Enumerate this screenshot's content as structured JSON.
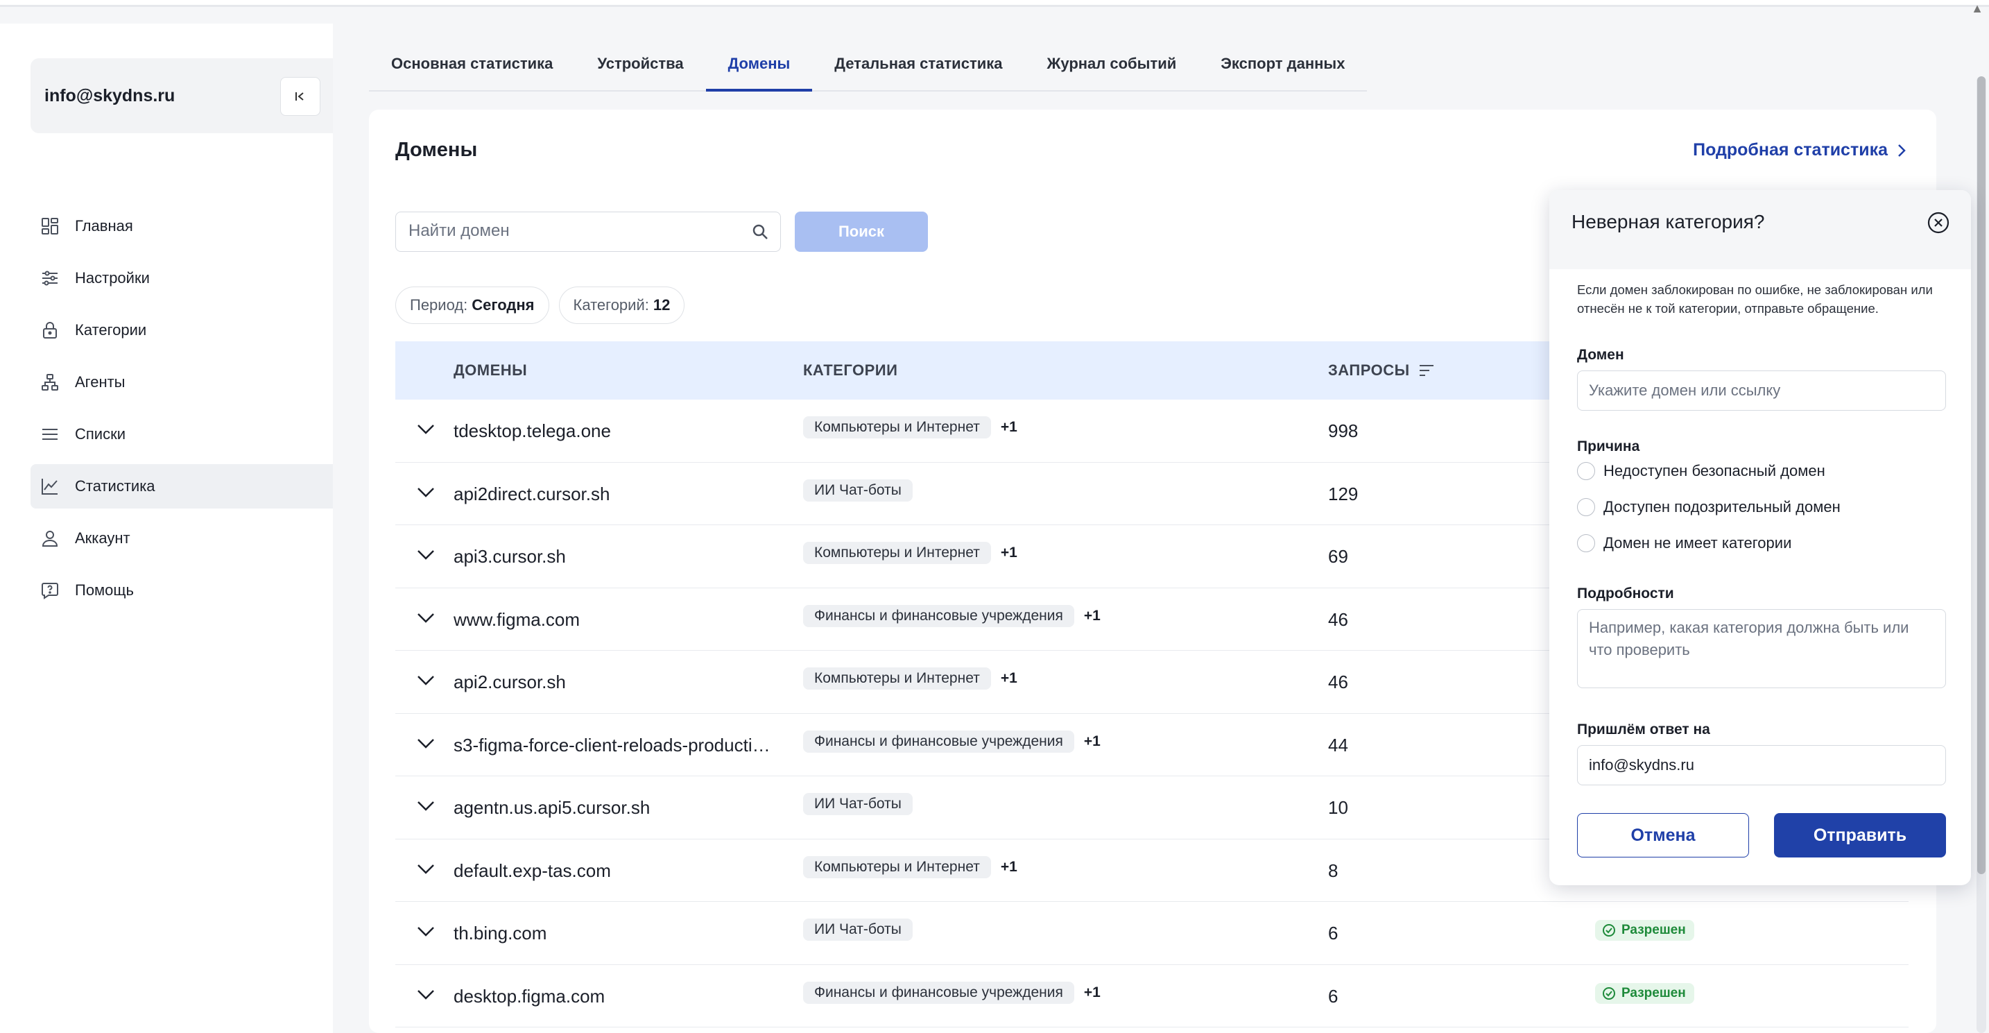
{
  "sidebar": {
    "user_email": "info@skydns.ru",
    "items": [
      {
        "label": "Главная",
        "icon": "grid-icon"
      },
      {
        "label": "Настройки",
        "icon": "sliders-icon"
      },
      {
        "label": "Категории",
        "icon": "lock-icon"
      },
      {
        "label": "Агенты",
        "icon": "network-icon"
      },
      {
        "label": "Списки",
        "icon": "list-icon"
      },
      {
        "label": "Статистика",
        "icon": "chart-icon",
        "active": true
      },
      {
        "label": "Аккаунт",
        "icon": "user-icon"
      },
      {
        "label": "Помощь",
        "icon": "help-icon"
      }
    ]
  },
  "tabs": [
    {
      "label": "Основная статистика"
    },
    {
      "label": "Устройства"
    },
    {
      "label": "Домены",
      "active": true
    },
    {
      "label": "Детальная статистика"
    },
    {
      "label": "Журнал событий"
    },
    {
      "label": "Экспорт данных"
    }
  ],
  "main": {
    "title": "Домены",
    "details_link": "Подробная статистика",
    "search_placeholder": "Найти домен",
    "search_button": "Поиск",
    "period_label": "Период:",
    "period_value": "Сегодня",
    "categories_label": "Категорий:",
    "categories_value": "12"
  },
  "table": {
    "headers": {
      "domain": "ДОМЕНЫ",
      "categories": "КАТЕГОРИИ",
      "requests": "ЗАПРОСЫ"
    },
    "rows": [
      {
        "domain": "tdesktop.telega.one",
        "category": "Компьютеры и Интернет",
        "more": "+1",
        "requests": "998",
        "status": ""
      },
      {
        "domain": "api2direct.cursor.sh",
        "category": "ИИ Чат-боты",
        "more": "",
        "requests": "129",
        "status": ""
      },
      {
        "domain": "api3.cursor.sh",
        "category": "Компьютеры и Интернет",
        "more": "+1",
        "requests": "69",
        "status": ""
      },
      {
        "domain": "www.figma.com",
        "category": "Финансы и финансовые учреждения",
        "more": "+1",
        "requests": "46",
        "status": ""
      },
      {
        "domain": "api2.cursor.sh",
        "category": "Компьютеры и Интернет",
        "more": "+1",
        "requests": "46",
        "status": ""
      },
      {
        "domain": "s3-figma-force-client-reloads-producti…",
        "category": "Финансы и финансовые учреждения",
        "more": "+1",
        "requests": "44",
        "status": ""
      },
      {
        "domain": "agentn.us.api5.cursor.sh",
        "category": "ИИ Чат-боты",
        "more": "",
        "requests": "10",
        "status": ""
      },
      {
        "domain": "default.exp-tas.com",
        "category": "Компьютеры и Интернет",
        "more": "+1",
        "requests": "8",
        "status": ""
      },
      {
        "domain": "th.bing.com",
        "category": "ИИ Чат-боты",
        "more": "",
        "requests": "6",
        "status": "Разрешен"
      },
      {
        "domain": "desktop.figma.com",
        "category": "Финансы и финансовые учреждения",
        "more": "+1",
        "requests": "6",
        "status": "Разрешен"
      }
    ]
  },
  "popup": {
    "title": "Неверная категория?",
    "description": "Если домен заблокирован по ошибке, не заблокирован или отнесён не к той категории, отправьте обращение.",
    "domain_label": "Домен",
    "domain_placeholder": "Укажите домен или ссылку",
    "reason_label": "Причина",
    "reasons": [
      "Недоступен безопасный домен",
      "Доступен подозрительный домен",
      "Домен не имеет категории"
    ],
    "details_label": "Подробности",
    "details_placeholder": "Например, какая категория должна быть или что проверить",
    "reply_label": "Пришлём ответ на",
    "reply_value": "info@skydns.ru",
    "cancel_button": "Отмена",
    "submit_button": "Отправить"
  },
  "colors": {
    "accent": "#1f3fa8",
    "table_header_bg": "#e6efff",
    "status_allowed": "#1e8a3a",
    "search_button_disabled": "#a9bff2"
  }
}
